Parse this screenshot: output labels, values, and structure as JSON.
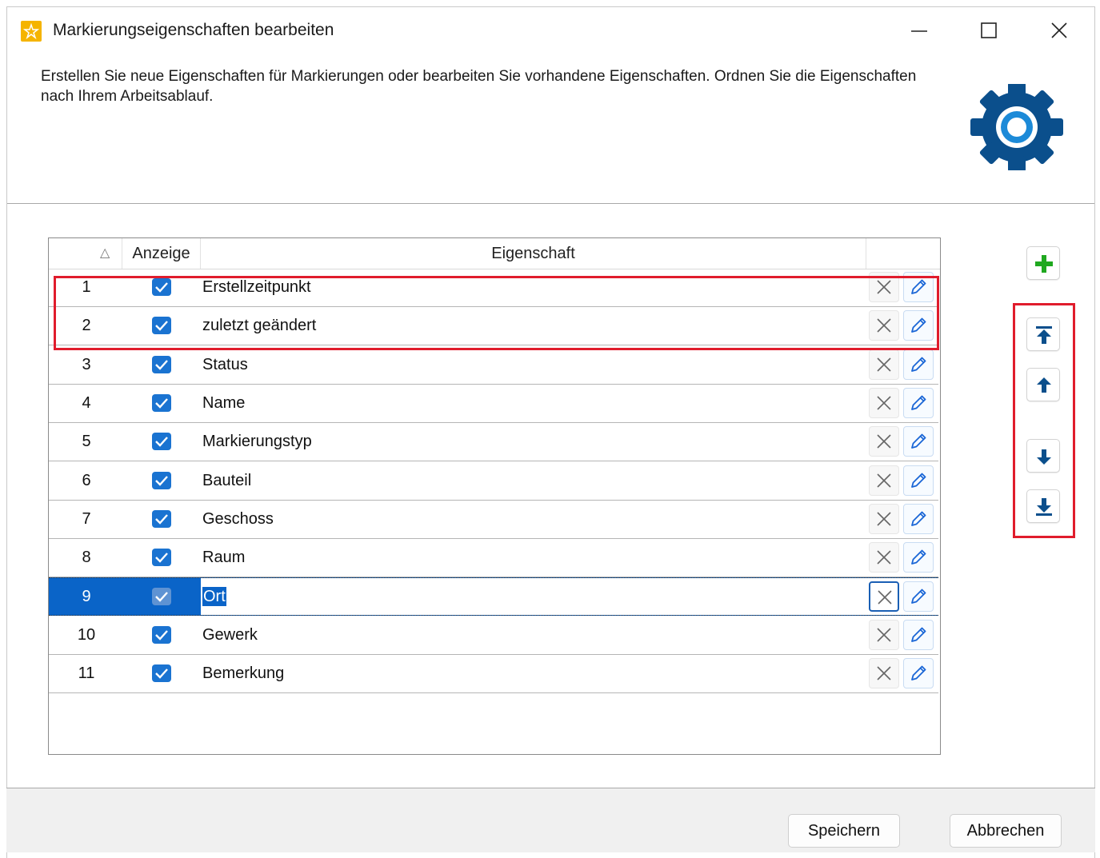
{
  "window": {
    "title": "Markierungseigenschaften bearbeiten",
    "icon": "app-star-icon",
    "controls": [
      "minimize-icon",
      "maximize-icon",
      "close-icon"
    ]
  },
  "header": {
    "description": "Erstellen Sie neue Eigenschaften für Markierungen oder bearbeiten Sie vorhandene Eigenschaften. Ordnen Sie die Eigenschaften nach Ihrem Arbeitsablauf.",
    "icon": "gear-icon"
  },
  "table": {
    "columns": {
      "number_sort_indicator": "△",
      "display": "Anzeige",
      "property": "Eigenschaft",
      "actions": ""
    },
    "rows": [
      {
        "number": "1",
        "checked": true,
        "name": "Erstellzeitpunkt"
      },
      {
        "number": "2",
        "checked": true,
        "name": "zuletzt geändert"
      },
      {
        "number": "3",
        "checked": true,
        "name": "Status"
      },
      {
        "number": "4",
        "checked": true,
        "name": "Name"
      },
      {
        "number": "5",
        "checked": true,
        "name": "Markierungstyp"
      },
      {
        "number": "6",
        "checked": true,
        "name": "Bauteil"
      },
      {
        "number": "7",
        "checked": true,
        "name": "Geschoss"
      },
      {
        "number": "8",
        "checked": true,
        "name": "Raum"
      },
      {
        "number": "9",
        "checked": true,
        "name": "Ort",
        "selected": true
      },
      {
        "number": "10",
        "checked": true,
        "name": "Gewerk"
      },
      {
        "number": "11",
        "checked": true,
        "name": "Bemerkung"
      }
    ],
    "row_actions": [
      "delete-x-icon",
      "edit-pencil-icon"
    ]
  },
  "side_toolbar": {
    "add": "add-plus-icon",
    "move_top": "move-to-top-icon",
    "move_up": "move-up-icon",
    "move_down": "move-down-icon",
    "move_bottom": "move-to-bottom-icon"
  },
  "footer": {
    "save_label": "Speichern",
    "cancel_label": "Abbrechen"
  },
  "colors": {
    "accent": "#0a64c8",
    "checkbox": "#1a73d1",
    "add_green": "#1fa81f",
    "arrow_blue": "#0b4f8c",
    "highlight_red": "#e01c2c",
    "gear_blue": "#0b4f8c"
  }
}
